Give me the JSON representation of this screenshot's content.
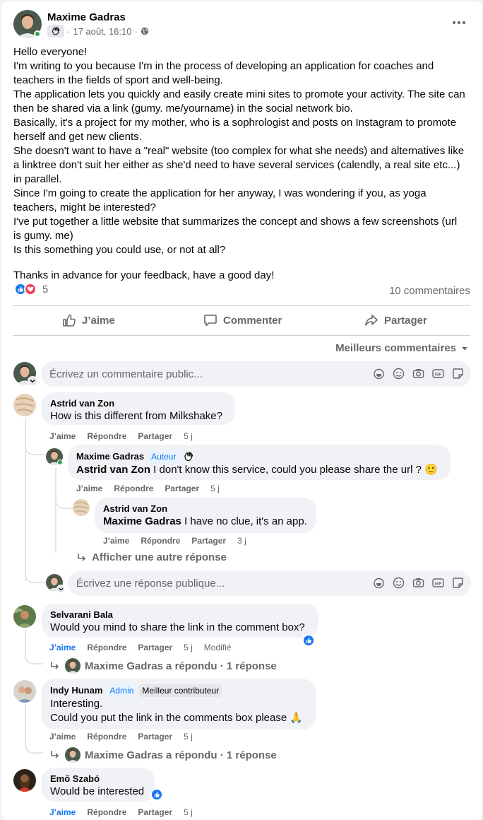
{
  "post": {
    "author": "Maxime Gadras",
    "timestamp": "17 août, 16:10",
    "paragraphs": [
      "Hello everyone!",
      "I'm writing to you because I'm in the process of developing an application for coaches and teachers in the fields of sport and well-being.",
      "The application lets you quickly and easily create mini sites to promote your activity. The site can then be shared via a link (gumy. me/yourname) in the social network bio.",
      "Basically, it's a project for my mother, who is a sophrologist and posts on Instagram to promote herself and get new clients.",
      "She doesn't want to have a \"real\" website (too complex for what she needs) and alternatives like a linktree don't suit her either as she'd need to have several services (calendly, a real site etc...) in parallel.",
      "Since I'm going to create the application for her anyway, I was wondering if you, as yoga teachers, might be interested?",
      "I've put together a little website that summarizes the concept and shows a few screenshots (url is gumy. me)",
      "Is this something you could use, or not at all?"
    ],
    "closing": "Thanks in advance for your feedback, have a good day!",
    "reaction_count": "5",
    "comment_count": "10 commentaires"
  },
  "actions": {
    "like": "J’aime",
    "comment": "Commenter",
    "share": "Partager"
  },
  "sort_label": "Meilleurs commentaires",
  "comment_placeholder": "Écrivez un commentaire public...",
  "reply_placeholder": "Écrivez une réponse publique...",
  "labels": {
    "like": "J’aime",
    "reply": "Répondre",
    "share": "Partager",
    "edited": "Modifié",
    "author_badge": "Auteur",
    "admin_badge": "Admin",
    "top_contributor": "Meilleur contributeur",
    "more_reply": "Afficher une autre réponse"
  },
  "comments": [
    {
      "name": "Astrid van Zon",
      "text": "How is this different from Milkshake?",
      "time": "5 j"
    },
    {
      "name": "Maxime Gadras",
      "mention": "Astrid van Zon",
      "text": " I don't know this service, could you please share the url ? 🙂",
      "time": "5 j"
    },
    {
      "name": "Astrid van Zon",
      "mention": "Maxime Gadras",
      "text": " I have no clue, it's an app.",
      "time": "3 j"
    },
    {
      "name": "Selvarani Bala",
      "text": "Would you mind to share the link in the comment box?",
      "time": "5 j",
      "replied": "Maxime Gadras a répondu · 1 réponse"
    },
    {
      "name": "Indy Hunam",
      "text_line1": "Interesting.",
      "text_line2": "Could you put the link in the comments box please 🙏",
      "time": "5 j",
      "replied": "Maxime Gadras a répondu · 1 réponse"
    },
    {
      "name": "Emő Szabó",
      "text": "Would be interested",
      "time": "5 j"
    }
  ],
  "colors": {
    "facebook_blue": "#1877f2",
    "secondary_text": "#65676b",
    "bubble_bg": "#f0f2f5",
    "online_green": "#31a24c"
  }
}
